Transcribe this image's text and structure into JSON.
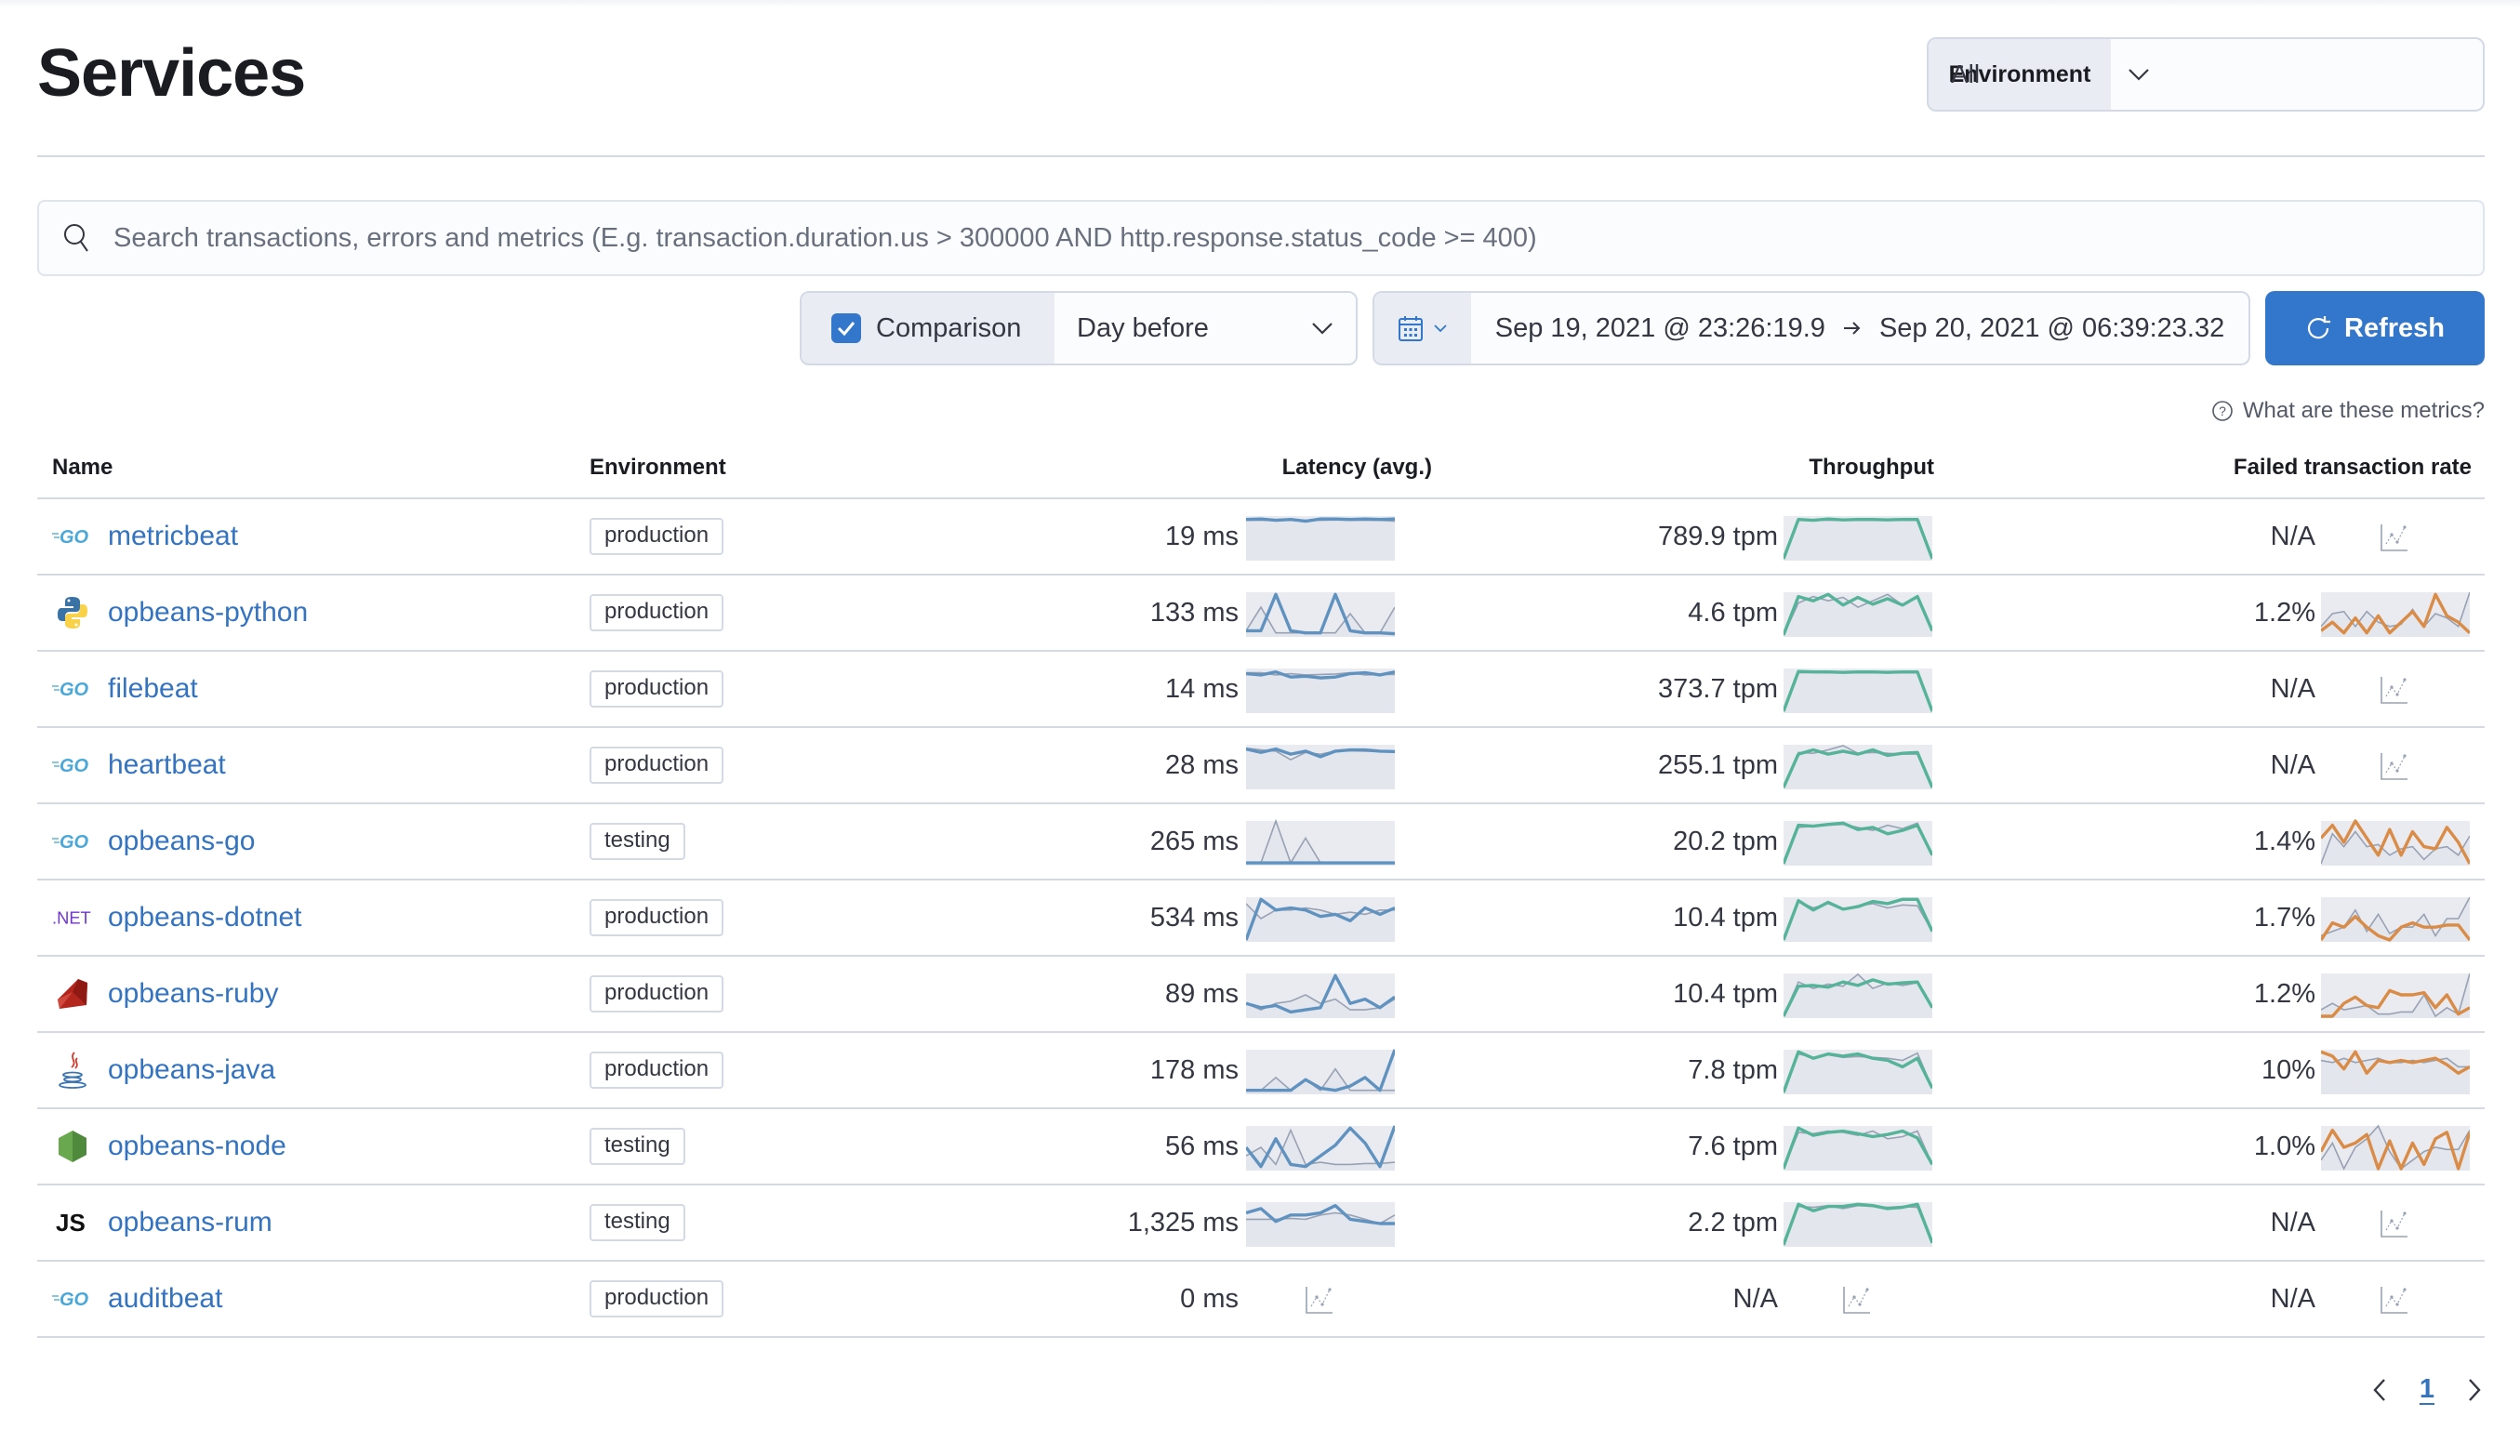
{
  "page": {
    "title": "Services"
  },
  "environment_select": {
    "label": "Environment",
    "value": "All"
  },
  "search": {
    "placeholder": "Search transactions, errors and metrics (E.g. transaction.duration.us > 300000 AND http.response.status_code >= 400)",
    "value": ""
  },
  "comparison": {
    "label": "Comparison",
    "checked": true,
    "value": "Day before"
  },
  "date_range": {
    "start": "Sep 19, 2021 @ 23:26:19.9",
    "end": "Sep 20, 2021 @ 06:39:23.32"
  },
  "refresh_label": "Refresh",
  "help_link": "What are these metrics?",
  "colors": {
    "primary": "#3377cc",
    "latency": "#6092c0",
    "throughput": "#54b399",
    "failed": "#da8b45",
    "comparison": "#98a2b3",
    "spark_fill": "#e9ebf1"
  },
  "table": {
    "columns": [
      "Name",
      "Environment",
      "Latency (avg.)",
      "Throughput",
      "Failed transaction rate"
    ],
    "rows": [
      {
        "agent": "go",
        "name": "metricbeat",
        "environment": "production",
        "latency": "19 ms",
        "throughput": "789.9 tpm",
        "failed": "N/A",
        "lat_cur": [
          0.92,
          0.93,
          0.9,
          0.92,
          0.88,
          0.93,
          0.93,
          0.92,
          0.93,
          0.92,
          0.93
        ],
        "lat_prev": [
          0.9,
          0.9,
          0.9,
          0.91,
          0.9,
          0.9,
          0.91,
          0.9,
          0.9,
          0.9,
          0.88
        ],
        "thr_cur": [
          0,
          0.92,
          0.9,
          0.93,
          0.91,
          0.92,
          0.92,
          0.91,
          0.92,
          0.92,
          0
        ],
        "thr_prev": [
          0,
          0.9,
          0.9,
          0.9,
          0.9,
          0.9,
          0.9,
          0.9,
          0.9,
          0.9,
          0
        ],
        "fail_cur": null,
        "fail_prev": null
      },
      {
        "agent": "python",
        "name": "opbeans-python",
        "environment": "production",
        "latency": "133 ms",
        "throughput": "4.6 tpm",
        "failed": "1.2%",
        "lat_cur": [
          0.1,
          0.1,
          0.95,
          0.1,
          0.05,
          0.05,
          0.95,
          0.1,
          0.05,
          0.05,
          0.03
        ],
        "lat_prev": [
          0.1,
          0.65,
          0.05,
          0.05,
          0.05,
          0.05,
          0.05,
          0.5,
          0.05,
          0.05,
          0.65
        ],
        "thr_cur": [
          0,
          0.9,
          0.8,
          0.95,
          0.7,
          0.88,
          0.72,
          0.85,
          0.7,
          0.9,
          0.1
        ],
        "thr_prev": [
          0,
          0.75,
          0.9,
          0.8,
          0.88,
          0.65,
          0.8,
          0.95,
          0.7,
          0.92,
          0.1
        ],
        "fail_cur": [
          0.1,
          0.3,
          0.05,
          0.4,
          0.05,
          0.45,
          0.05,
          0.3,
          0.55,
          0.2,
          0.95,
          0.45,
          0.3,
          0.05
        ],
        "fail_prev": [
          0.2,
          0.5,
          0.55,
          0.2,
          0.55,
          0.3,
          0.2,
          0.25,
          0.6,
          0.2,
          0.5,
          0.4,
          0.2,
          1.0
        ]
      },
      {
        "agent": "go",
        "name": "filebeat",
        "environment": "production",
        "latency": "14 ms",
        "throughput": "373.7 tpm",
        "failed": "N/A",
        "lat_cur": [
          0.88,
          0.85,
          0.92,
          0.8,
          0.82,
          0.78,
          0.8,
          0.88,
          0.9,
          0.85,
          0.92
        ],
        "lat_prev": [
          0.9,
          0.9,
          0.85,
          0.88,
          0.85,
          0.86,
          0.87,
          0.9,
          0.85,
          0.86,
          0.86
        ],
        "thr_cur": [
          0,
          0.93,
          0.92,
          0.92,
          0.91,
          0.92,
          0.92,
          0.91,
          0.92,
          0.92,
          0
        ],
        "thr_prev": [
          0,
          0.9,
          0.91,
          0.9,
          0.9,
          0.9,
          0.9,
          0.9,
          0.9,
          0.9,
          0
        ],
        "fail_cur": null,
        "fail_prev": null
      },
      {
        "agent": "go",
        "name": "heartbeat",
        "environment": "production",
        "latency": "28 ms",
        "throughput": "255.1 tpm",
        "failed": "N/A",
        "lat_cur": [
          0.9,
          0.82,
          0.9,
          0.78,
          0.85,
          0.72,
          0.85,
          0.88,
          0.88,
          0.85,
          0.84
        ],
        "lat_prev": [
          0.92,
          0.88,
          0.85,
          0.65,
          0.82,
          0.78,
          0.85,
          0.86,
          0.85,
          0.84,
          0.82
        ],
        "thr_cur": [
          0,
          0.78,
          0.88,
          0.78,
          0.85,
          0.78,
          0.88,
          0.75,
          0.8,
          0.82,
          0
        ],
        "thr_prev": [
          0,
          0.82,
          0.8,
          0.88,
          0.98,
          0.8,
          0.82,
          0.8,
          0.78,
          0.78,
          0
        ],
        "fail_cur": null,
        "fail_prev": null
      },
      {
        "agent": "go",
        "name": "opbeans-go",
        "environment": "testing",
        "latency": "265 ms",
        "throughput": "20.2 tpm",
        "failed": "1.4%",
        "lat_cur": [
          0.02,
          0.02,
          0.02,
          0.02,
          0.02,
          0.02,
          0.02,
          0.02,
          0.02,
          0.02,
          0.02
        ],
        "lat_prev": [
          0.02,
          0.02,
          1.0,
          0.02,
          0.6,
          0.02,
          0.02,
          0.02,
          0.02,
          0.02,
          0.02
        ],
        "thr_cur": [
          0,
          0.9,
          0.88,
          0.92,
          0.95,
          0.8,
          0.85,
          0.7,
          0.78,
          0.9,
          0.2
        ],
        "thr_prev": [
          0,
          0.85,
          0.88,
          0.9,
          0.92,
          0.85,
          0.78,
          0.9,
          0.82,
          0.95,
          0.2
        ],
        "fail_cur": [
          0.6,
          0.9,
          0.5,
          1.0,
          0.6,
          0.2,
          0.8,
          0.2,
          0.75,
          0.4,
          0.35,
          0.85,
          0.5,
          0.0
        ],
        "fail_prev": [
          0.0,
          0.7,
          0.4,
          0.75,
          0.4,
          0.45,
          0.2,
          0.35,
          0.4,
          0.1,
          0.35,
          0.4,
          0.2,
          0.65
        ]
      },
      {
        "agent": "dotnet",
        "name": "opbeans-dotnet",
        "environment": "production",
        "latency": "534 ms",
        "throughput": "10.4 tpm",
        "failed": "1.7%",
        "lat_cur": [
          0.0,
          0.95,
          0.7,
          0.75,
          0.7,
          0.55,
          0.6,
          0.45,
          0.75,
          0.6,
          0.75
        ],
        "lat_prev": [
          0.85,
          0.5,
          0.7,
          0.7,
          0.75,
          0.7,
          0.6,
          0.65,
          0.6,
          0.7,
          0.7
        ],
        "thr_cur": [
          0,
          0.92,
          0.7,
          0.88,
          0.72,
          0.78,
          0.9,
          0.85,
          0.95,
          0.95,
          0.2
        ],
        "thr_prev": [
          0,
          0.9,
          0.75,
          0.85,
          0.72,
          0.8,
          0.85,
          0.75,
          0.82,
          0.8,
          0.2
        ],
        "fail_cur": [
          0.0,
          0.4,
          0.3,
          0.55,
          0.3,
          0.1,
          0.0,
          0.3,
          0.4,
          0.3,
          0.3,
          0.35,
          0.35,
          0.0
        ],
        "fail_prev": [
          0.1,
          0.2,
          0.3,
          0.7,
          0.2,
          0.6,
          0.15,
          0.3,
          0.3,
          0.6,
          0.1,
          0.5,
          0.5,
          1.0
        ]
      },
      {
        "agent": "ruby",
        "name": "opbeans-ruby",
        "environment": "production",
        "latency": "89 ms",
        "throughput": "10.4 tpm",
        "failed": "1.2%",
        "lat_cur": [
          0.3,
          0.2,
          0.25,
          0.1,
          0.15,
          0.2,
          0.95,
          0.3,
          0.4,
          0.2,
          0.45
        ],
        "lat_prev": [
          0.3,
          0.15,
          0.3,
          0.35,
          0.5,
          0.3,
          0.4,
          0.15,
          0.15,
          0.2,
          0.4
        ],
        "thr_cur": [
          0,
          0.7,
          0.72,
          0.68,
          0.8,
          0.72,
          0.85,
          0.75,
          0.78,
          0.8,
          0.2
        ],
        "thr_prev": [
          0,
          0.8,
          0.65,
          0.75,
          0.7,
          0.98,
          0.65,
          0.78,
          0.72,
          0.78,
          0.2
        ],
        "fail_cur": [
          0.0,
          0.0,
          0.3,
          0.45,
          0.25,
          0.2,
          0.6,
          0.5,
          0.5,
          0.55,
          0.2,
          0.5,
          0.05,
          0.2
        ],
        "fail_prev": [
          0.15,
          0.3,
          0.15,
          0.2,
          0.25,
          0.05,
          0.05,
          0.1,
          0.1,
          0.5,
          0.0,
          0.2,
          0.05,
          1.0
        ]
      },
      {
        "agent": "java",
        "name": "opbeans-java",
        "environment": "production",
        "latency": "178 ms",
        "throughput": "7.8 tpm",
        "failed": "10%",
        "lat_cur": [
          0.05,
          0.05,
          0.05,
          0.05,
          0.3,
          0.1,
          0.05,
          0.15,
          0.35,
          0.05,
          1.0
        ],
        "lat_prev": [
          0.05,
          0.05,
          0.35,
          0.05,
          0.3,
          0.05,
          0.55,
          0.05,
          0.05,
          0.05,
          0.05
        ],
        "thr_cur": [
          0,
          0.95,
          0.8,
          0.9,
          0.85,
          0.9,
          0.8,
          0.75,
          0.6,
          0.8,
          0.1
        ],
        "thr_prev": [
          0,
          0.9,
          0.82,
          0.88,
          0.82,
          0.84,
          0.82,
          0.8,
          0.75,
          0.92,
          0.1
        ],
        "fail_cur": [
          0.95,
          0.85,
          0.55,
          0.95,
          0.45,
          0.75,
          0.7,
          0.75,
          0.7,
          0.75,
          0.8,
          0.65,
          0.45,
          0.6
        ],
        "fail_prev": [
          0.75,
          0.7,
          0.8,
          0.7,
          0.75,
          0.8,
          0.7,
          0.7,
          0.75,
          0.7,
          0.75,
          0.8,
          0.6,
          0.6
        ]
      },
      {
        "agent": "nodejs",
        "name": "opbeans-node",
        "environment": "testing",
        "latency": "56 ms",
        "throughput": "7.6 tpm",
        "failed": "1.0%",
        "lat_cur": [
          0.5,
          0.05,
          0.7,
          0.1,
          0.05,
          0.3,
          0.55,
          0.95,
          0.6,
          0.05,
          1.0
        ],
        "lat_prev": [
          0.3,
          0.5,
          0.1,
          0.9,
          0.1,
          0.15,
          0.1,
          0.1,
          0.12,
          0.12,
          0.15
        ],
        "thr_cur": [
          0,
          0.95,
          0.78,
          0.85,
          0.88,
          0.82,
          0.75,
          0.8,
          0.88,
          0.72,
          0.1
        ],
        "thr_prev": [
          0,
          0.85,
          0.82,
          0.88,
          0.85,
          0.78,
          0.88,
          0.7,
          0.75,
          0.88,
          0.1
        ],
        "fail_cur": [
          0.4,
          0.9,
          0.5,
          0.6,
          0.8,
          0.0,
          0.65,
          0.0,
          0.6,
          0.1,
          0.7,
          0.85,
          0.0,
          0.85
        ],
        "fail_prev": [
          0.2,
          0.6,
          0.0,
          0.5,
          0.7,
          1.0,
          0.4,
          0.0,
          0.2,
          0.4,
          0.5,
          0.45,
          0.45,
          0.9
        ]
      },
      {
        "agent": "rum-js",
        "name": "opbeans-rum",
        "environment": "testing",
        "latency": "1,325 ms",
        "throughput": "2.2 tpm",
        "failed": "N/A",
        "lat_cur": [
          0.75,
          0.85,
          0.55,
          0.7,
          0.7,
          0.75,
          0.92,
          0.6,
          0.55,
          0.5,
          0.5
        ],
        "lat_prev": [
          0.6,
          0.6,
          0.6,
          0.62,
          0.6,
          0.7,
          0.75,
          0.7,
          0.6,
          0.5,
          0.7
        ],
        "thr_cur": [
          0,
          0.95,
          0.8,
          0.9,
          0.9,
          0.95,
          0.92,
          0.85,
          0.88,
          0.95,
          0.05
        ],
        "thr_prev": [
          0,
          0.9,
          0.88,
          0.92,
          0.85,
          0.92,
          0.9,
          0.88,
          0.9,
          0.88,
          0.05
        ],
        "fail_cur": null,
        "fail_prev": null
      },
      {
        "agent": "go",
        "name": "auditbeat",
        "environment": "production",
        "latency": "0 ms",
        "throughput": "N/A",
        "failed": "N/A",
        "lat_cur": null,
        "lat_prev": null,
        "thr_cur": null,
        "thr_prev": null,
        "fail_cur": null,
        "fail_prev": null
      }
    ]
  },
  "pagination": {
    "current_page": "1"
  }
}
